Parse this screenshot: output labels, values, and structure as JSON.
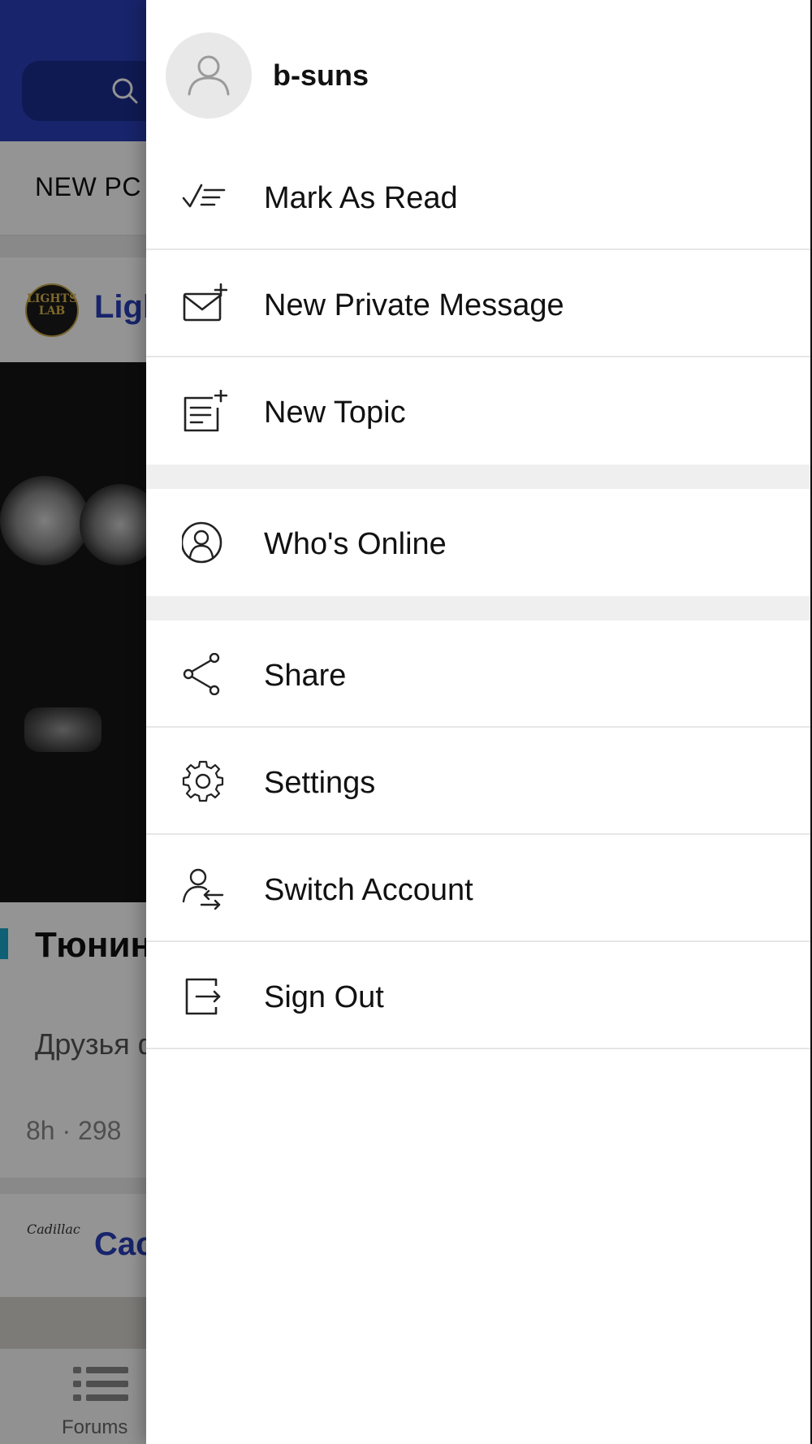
{
  "background": {
    "tab_label": "NEW PC",
    "post1": {
      "forum_name": "Ligl",
      "avatar_text": "LIGHTS LAB",
      "title": "Тюнин Lights",
      "excerpt": "Друзья фар мы",
      "meta": "8h · 298"
    },
    "post2": {
      "forum_name": "Cac",
      "avatar_text": "Cadillac"
    },
    "tabbar": {
      "forums_label": "Forums"
    }
  },
  "drawer": {
    "profile": {
      "username": "b-suns"
    },
    "menu": [
      {
        "label": "Mark As Read",
        "icon": "mark-read-icon"
      },
      {
        "label": "New Private Message",
        "icon": "new-message-icon"
      },
      {
        "label": "New Topic",
        "icon": "new-topic-icon"
      },
      {
        "label": "Who's Online",
        "icon": "whos-online-icon"
      },
      {
        "label": "Share",
        "icon": "share-icon"
      },
      {
        "label": "Settings",
        "icon": "settings-icon"
      },
      {
        "label": "Switch Account",
        "icon": "switch-account-icon"
      },
      {
        "label": "Sign Out",
        "icon": "sign-out-icon"
      }
    ]
  },
  "colors": {
    "header_blue": "#2a3fb8",
    "link_blue": "#2a3fb8",
    "accent_cyan": "#1aa6c9",
    "section_gap": "#efefef"
  }
}
